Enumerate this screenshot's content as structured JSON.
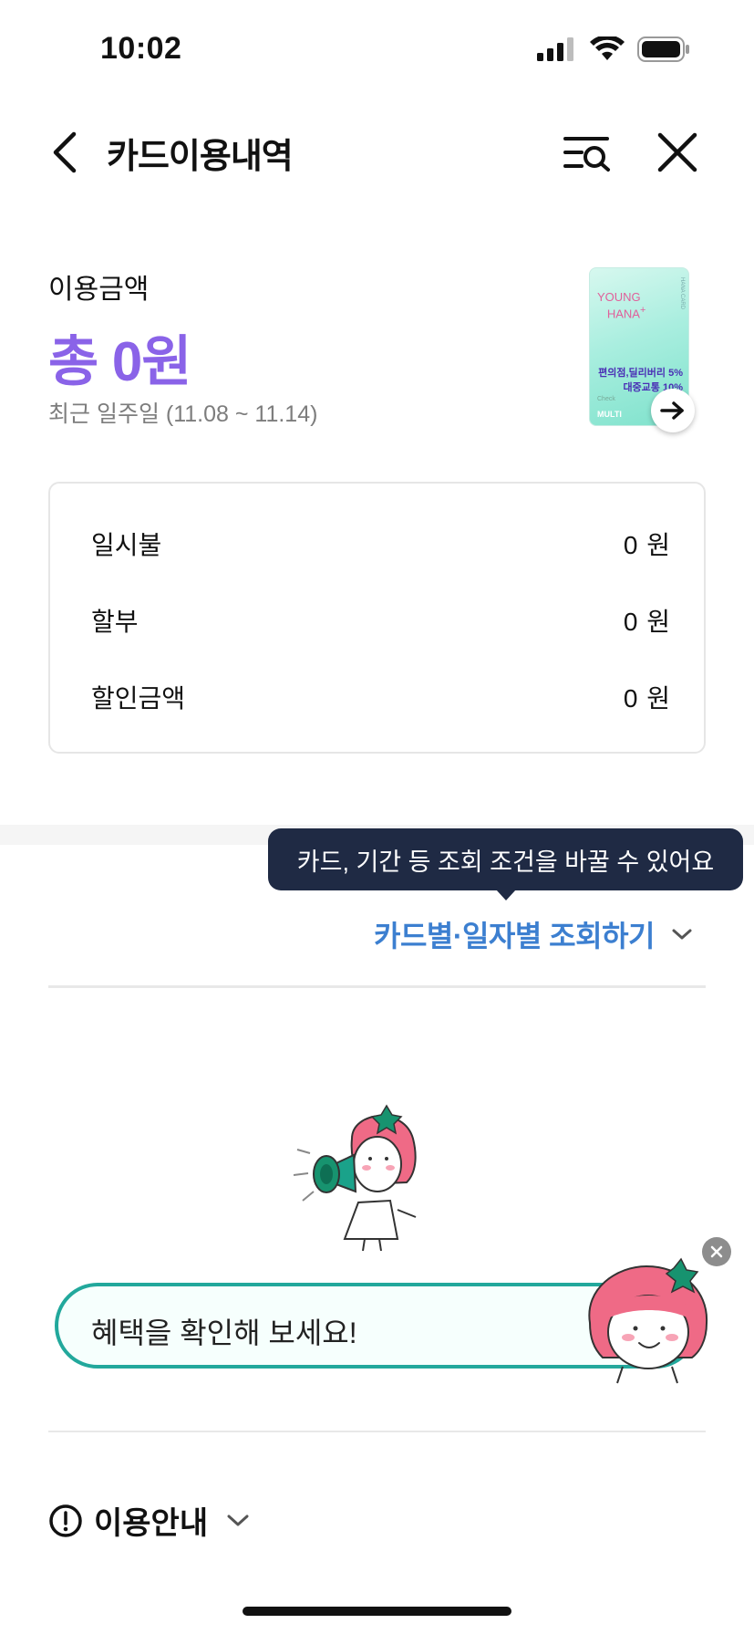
{
  "status_bar": {
    "time": "10:02",
    "icons": [
      "signal-icon",
      "wifi-icon",
      "battery-icon"
    ]
  },
  "nav": {
    "title": "카드이용내역",
    "icons": [
      "chevron-left-icon",
      "search-filter-icon",
      "close-icon"
    ]
  },
  "summary": {
    "label": "이용금액",
    "total": "총 0원",
    "period": "최근 일주일 (11.08 ~ 11.14)",
    "accent_color": "#8a63e8"
  },
  "card": {
    "brand_line1": "YOUNG",
    "brand_line2": "HANA",
    "brand_plus": "+",
    "side_text": "HANA CARD",
    "benefit_line1": "편의점,딜리버리 5%",
    "benefit_line2": "대중교통 10%",
    "benefit_line3": "커",
    "check_label": "Check",
    "multi_label": "MULTI"
  },
  "breakdown": {
    "rows": [
      {
        "label": "일시불",
        "amount": "0 원"
      },
      {
        "label": "할부",
        "amount": "0 원"
      },
      {
        "label": "할인금액",
        "amount": "0 원"
      }
    ]
  },
  "tooltip": {
    "text": "카드, 기간 등 조회 조건을 바꿀 수 있어요"
  },
  "filter": {
    "label": "카드별·일자별 조회하기",
    "color": "#3c7fd0"
  },
  "banner": {
    "text": "혜택을 확인해 보세요!",
    "border_color": "#22a89c"
  },
  "usage_guide": {
    "label": "이용안내"
  }
}
